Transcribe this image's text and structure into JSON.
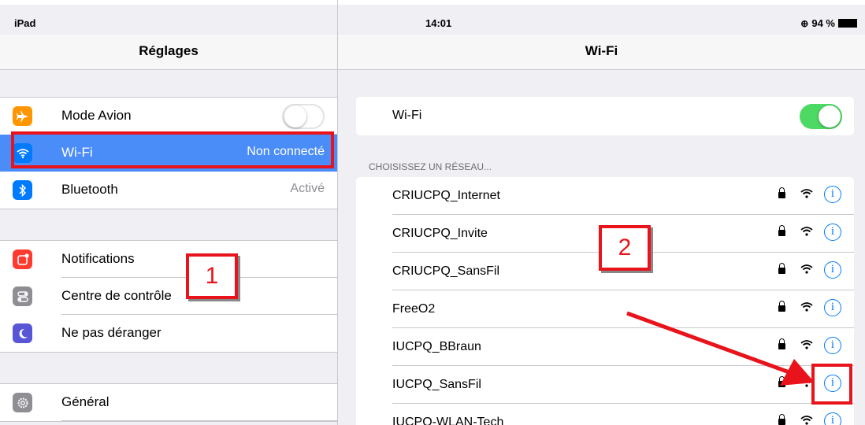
{
  "status_bar": {
    "carrier": "iPad",
    "time": "14:01",
    "battery": "94 %"
  },
  "left_nav": {
    "title": "Réglages"
  },
  "right_nav": {
    "title": "Wi-Fi"
  },
  "settings_group1": [
    {
      "label": "Mode Avion",
      "icon": "airplane-icon",
      "color": "#ff9500",
      "value": ""
    },
    {
      "label": "Wi-Fi",
      "icon": "wifi-icon",
      "color": "#007aff",
      "value": "Non connecté"
    },
    {
      "label": "Bluetooth",
      "icon": "bluetooth-icon",
      "color": "#007aff",
      "value": "Activé"
    }
  ],
  "settings_group2": [
    {
      "label": "Notifications",
      "icon": "notifications-icon",
      "color": "#ff3b30"
    },
    {
      "label": "Centre de contrôle",
      "icon": "control-center-icon",
      "color": "#8e8e93"
    },
    {
      "label": "Ne pas déranger",
      "icon": "moon-icon",
      "color": "#5856d6"
    }
  ],
  "settings_group3": [
    {
      "label": "Général",
      "icon": "gear-icon",
      "color": "#8e8e93"
    }
  ],
  "wifi_toggle": {
    "label": "Wi-Fi",
    "state": "on"
  },
  "network_section_header": "CHOISISSEZ UN RÉSEAU...",
  "networks": [
    {
      "name": "CRIUCPQ_Internet"
    },
    {
      "name": "CRIUCPQ_Invite"
    },
    {
      "name": "CRIUCPQ_SansFil"
    },
    {
      "name": "FreeO2"
    },
    {
      "name": "IUCPQ_BBraun"
    },
    {
      "name": "IUCPQ_SansFil"
    },
    {
      "name": "IUCPQ-WLAN-Tech"
    }
  ],
  "annotations": {
    "callout_1": "1",
    "callout_2": "2"
  },
  "colors": {
    "accent": "#007aff",
    "toggle_on": "#4cd964",
    "selected_row": "#4b8df8",
    "annotation_red": "#e8131b"
  }
}
